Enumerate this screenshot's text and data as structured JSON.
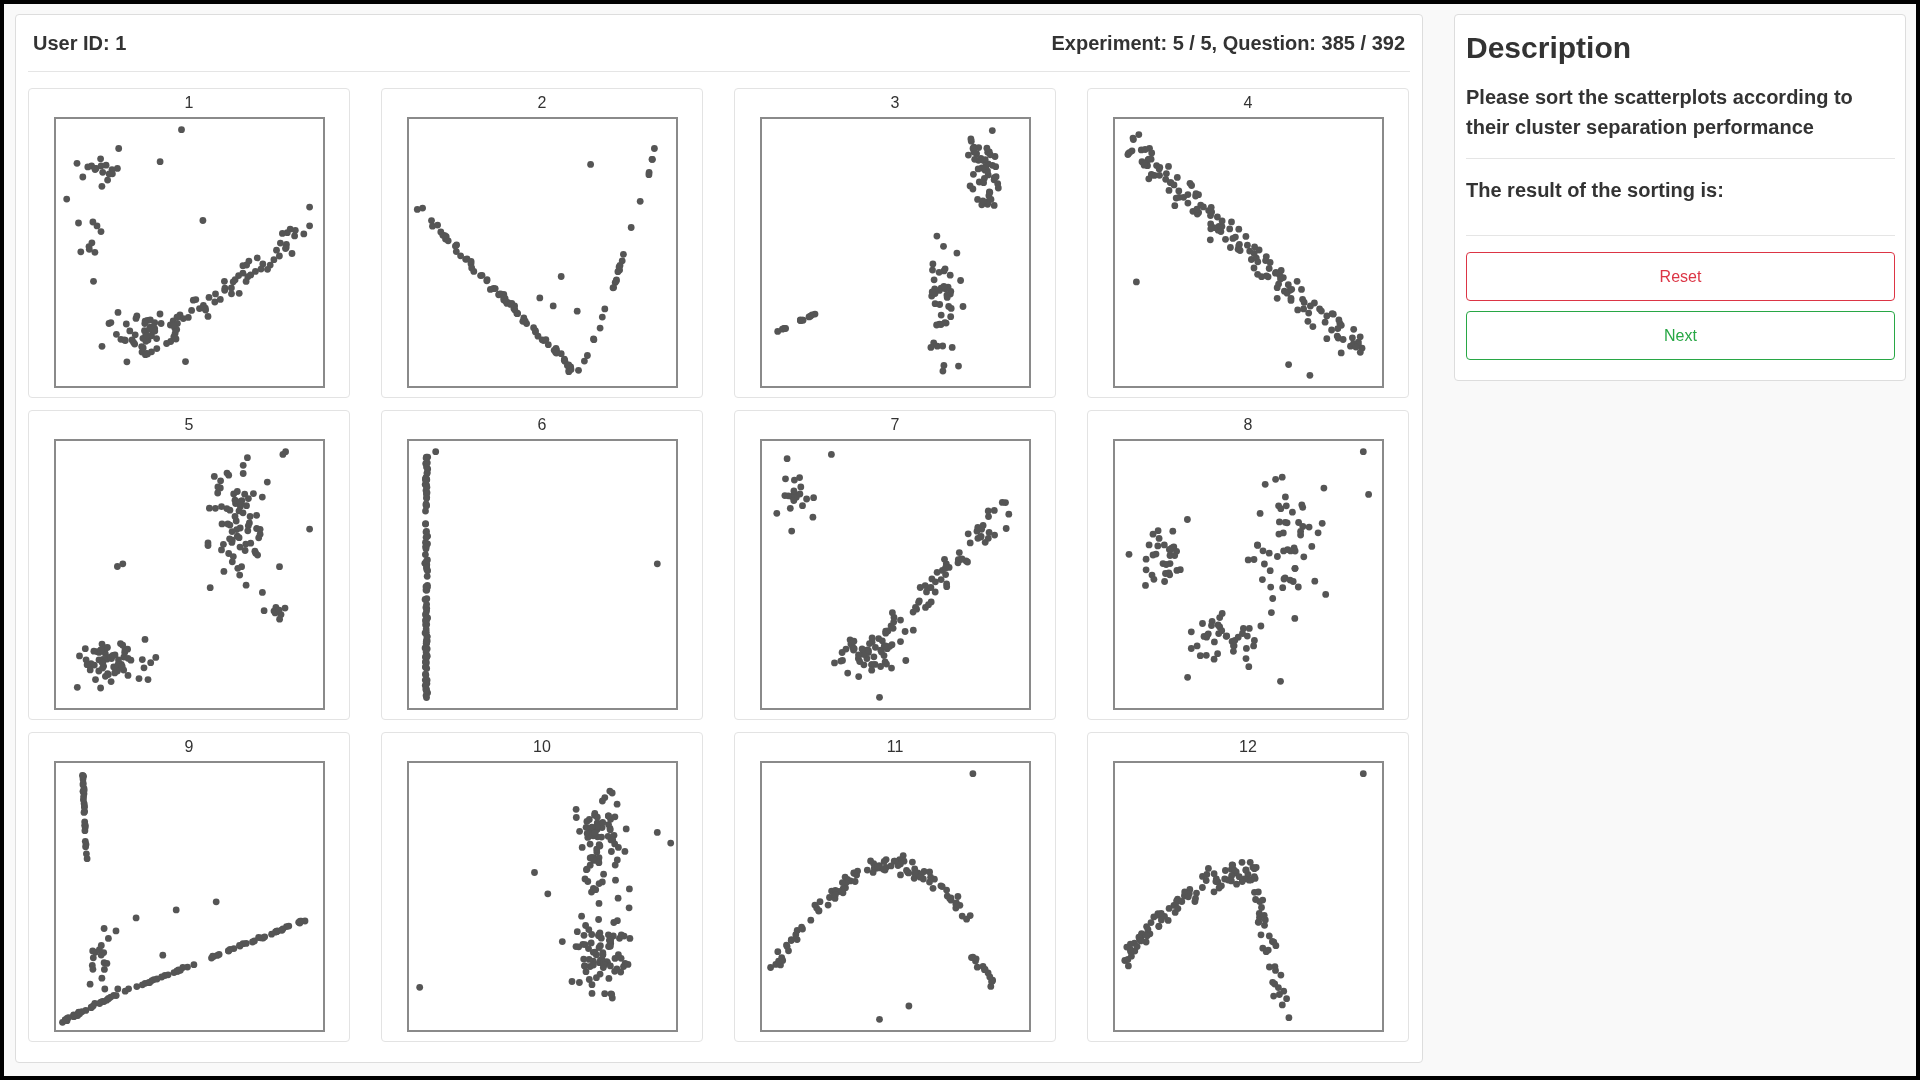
{
  "header": {
    "user_id": "User ID: 1",
    "progress": "Experiment: 5 / 5, Question: 385 / 392"
  },
  "scatterplots": [
    {
      "label": "1"
    },
    {
      "label": "2"
    },
    {
      "label": "3"
    },
    {
      "label": "4"
    },
    {
      "label": "5"
    },
    {
      "label": "6"
    },
    {
      "label": "7"
    },
    {
      "label": "8"
    },
    {
      "label": "9"
    },
    {
      "label": "10"
    },
    {
      "label": "11"
    },
    {
      "label": "12"
    }
  ],
  "description": {
    "title": "Description",
    "instruction": "Please sort the scatterplots according to their cluster separation performance",
    "result_label": "The result of the sorting is:"
  },
  "buttons": [
    {
      "label": "Reset",
      "kind": "reset"
    },
    {
      "label": "Next",
      "kind": "next"
    }
  ]
}
